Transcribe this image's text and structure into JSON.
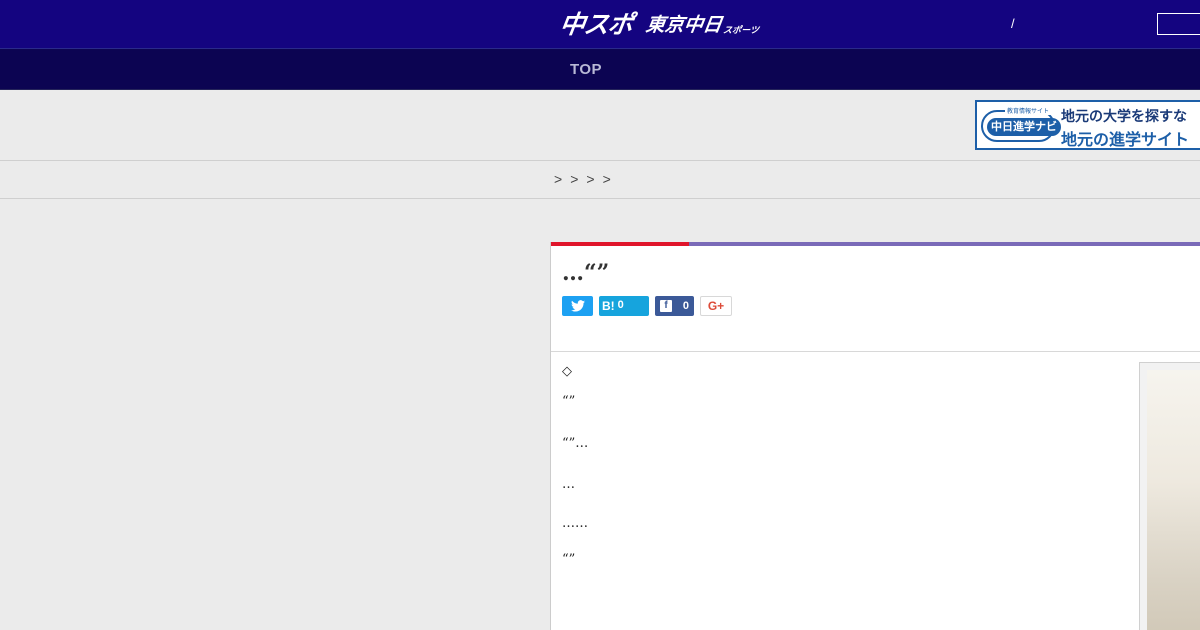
{
  "header": {
    "logo_main": "中スポ",
    "logo_sub": "東京中日",
    "logo_small": "スポーツ",
    "slash": "/"
  },
  "nav": {
    "items": [
      "TOP"
    ]
  },
  "ad": {
    "logo_top": "教育情報サイト",
    "logo_text": "中日進学ナビ",
    "line1": "地元の大学を探すな",
    "line2": "地元の進学サイト"
  },
  "breadcrumb": {
    "items": [
      ">",
      ">",
      ">",
      ">"
    ]
  },
  "article": {
    "title": "…“”",
    "share": {
      "twitter_label": "",
      "hatena_label": "B!",
      "hatena_count": "0",
      "facebook_count": "0",
      "gplus_label": "G+"
    },
    "paragraphs": [
      "◇",
      "“”",
      "“”…",
      "…",
      "……",
      "“”"
    ]
  },
  "colors": {
    "header_bg": "#140480",
    "nav_bg": "#0c0452",
    "accent_red": "#e0152b",
    "accent_purple": "#7a6ab8"
  }
}
